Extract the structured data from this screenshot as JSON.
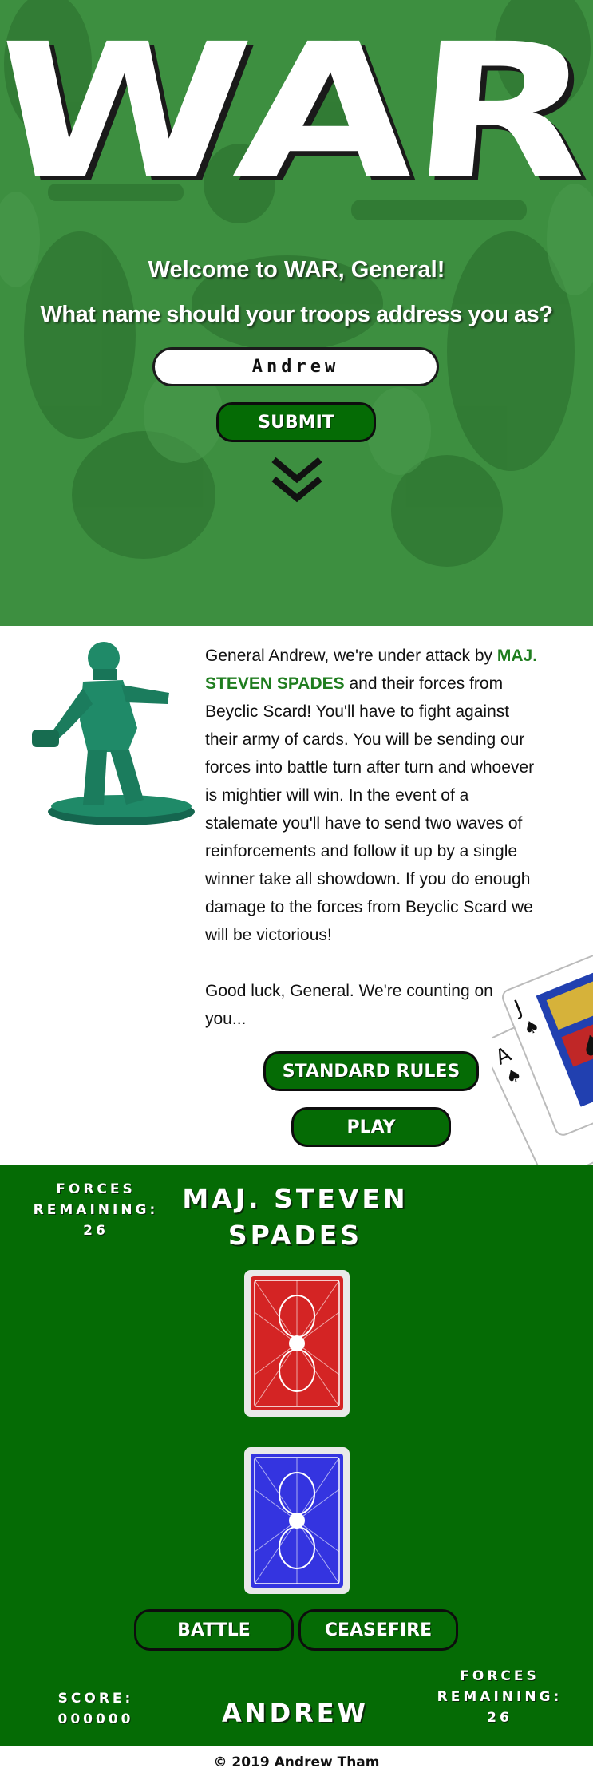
{
  "hero": {
    "title_letters": [
      "W",
      "A",
      "R"
    ],
    "welcome": "Welcome to WAR, General!",
    "prompt": "What name should your troops address you as?",
    "name_value": "Andrew",
    "submit_label": "SUBMIT",
    "background_color": "#3d8f40"
  },
  "briefing": {
    "text_before": "General Andrew, we're under attack by ",
    "enemy_name": "MAJ. STEVEN SPADES",
    "text_after": " and their forces from Beyclic Scard! You'll have to fight against their army of cards. You will be sending our forces into battle turn after turn and whoever is mightier will win. In the event of a stalemate you'll have to send two waves of reinforcements and follow it up by a single winner take all showdown. If you do enough damage to the forces from Beyclic Scard we will be victorious!",
    "good_luck": "Good luck, General. We're counting on you...",
    "rules_label": "STANDARD RULES",
    "play_label": "PLAY"
  },
  "board": {
    "enemy_forces_label": "FORCES REMAINING:",
    "enemy_forces_value": "26",
    "enemy_name": "MAJ. STEVEN SPADES",
    "battle_label": "BATTLE",
    "ceasefire_label": "CEASEFIRE",
    "score_label": "SCORE:",
    "score_value": "000000",
    "player_name": "ANDREW",
    "player_forces_label": "FORCES REMAINING:",
    "player_forces_value": "26",
    "background_color": "#056b05",
    "enemy_card_color": "#d42424",
    "player_card_color": "#3434e0"
  },
  "footer": {
    "text": "© 2019 Andrew Tham"
  }
}
